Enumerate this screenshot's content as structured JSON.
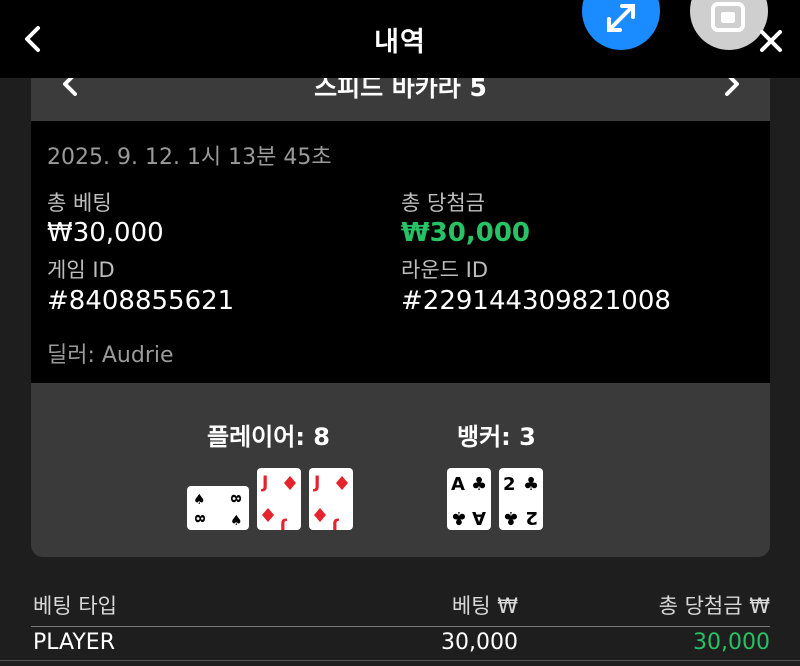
{
  "header": {
    "title": "내역"
  },
  "game": {
    "name": "스피드 바카라 5"
  },
  "round": {
    "timestamp": "2025. 9. 12. 1시 13분 45초",
    "total_bet_label": "총 베팅",
    "total_bet_value": "₩30,000",
    "total_win_label": "총 당첨금",
    "total_win_value": "₩30,000",
    "game_id_label": "게임 ID",
    "game_id_value": "#8408855621",
    "round_id_label": "라운드 ID",
    "round_id_value": "#229144309821008",
    "dealer": "딜러: Audrie"
  },
  "result": {
    "player_label": "플레이어: 8",
    "banker_label": "뱅커: 3",
    "player_cards": [
      {
        "rank": "8",
        "suit": "spade",
        "orientation": "sideways"
      },
      {
        "rank": "J",
        "suit": "diamond"
      },
      {
        "rank": "J",
        "suit": "diamond"
      }
    ],
    "banker_cards": [
      {
        "rank": "A",
        "suit": "club"
      },
      {
        "rank": "2",
        "suit": "club"
      }
    ]
  },
  "bets": {
    "headers": {
      "type": "베팅 타입",
      "bet": "베팅 ₩",
      "win": "총 당첨금 ₩"
    },
    "rows": [
      {
        "type": "PLAYER",
        "bet": "30,000",
        "win": "30,000"
      }
    ]
  },
  "colors": {
    "win": "#27c265",
    "expand_button": "#1a8cff",
    "diamond": "#e4232d"
  },
  "icons": [
    "back-icon",
    "expand-icon",
    "picture-in-picture-icon",
    "close-icon",
    "prev-icon",
    "next-icon"
  ]
}
